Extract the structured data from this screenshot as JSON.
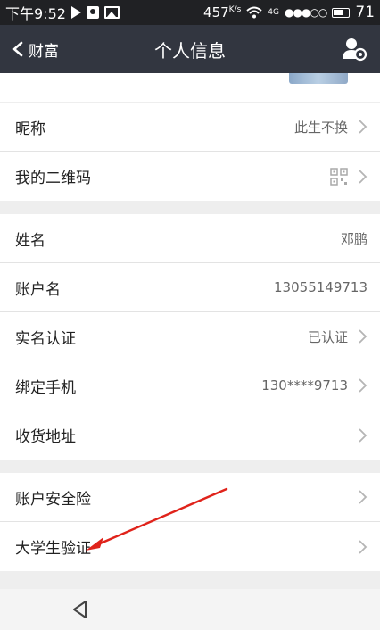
{
  "status_bar": {
    "time": "下午9:52",
    "speed": "457",
    "speed_unit": "K/s",
    "network": "4G",
    "signal_dots": "●●●○○",
    "battery": "71"
  },
  "header": {
    "back_label": "财富",
    "title": "个人信息"
  },
  "sections": {
    "group1": [
      {
        "label": "昵称",
        "value": "此生不换",
        "chevron": true
      },
      {
        "label": "我的二维码",
        "value": "",
        "chevron": true,
        "qr": true
      }
    ],
    "group2": [
      {
        "label": "姓名",
        "value": "邓鹏",
        "chevron": false
      },
      {
        "label": "账户名",
        "value": "13055149713",
        "chevron": false
      },
      {
        "label": "实名认证",
        "value": "已认证",
        "chevron": true
      },
      {
        "label": "绑定手机",
        "value": "130****9713",
        "chevron": true
      },
      {
        "label": "收货地址",
        "value": "",
        "chevron": true
      }
    ],
    "group3": [
      {
        "label": "账户安全险",
        "value": "",
        "chevron": true
      },
      {
        "label": "大学生验证",
        "value": "",
        "chevron": true
      }
    ]
  },
  "colors": {
    "header_bg": "#323640",
    "status_bg": "#202124",
    "annotation": "#e0231b"
  }
}
